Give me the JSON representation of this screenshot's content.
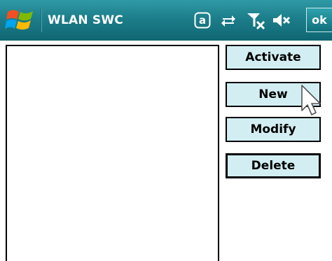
{
  "titlebar": {
    "title": "WLAN SWC",
    "ok_label": "ok",
    "start_icon": "windows-flag-icon",
    "status_icons": [
      "notification-a-icon",
      "connectivity-arrows-icon",
      "no-signal-icon",
      "speaker-muted-icon"
    ]
  },
  "buttons": {
    "activate": "Activate",
    "new": "New",
    "modify": "Modify",
    "delete": "Delete"
  },
  "list": {
    "items": []
  },
  "colors": {
    "titlebar": "#1c7e8a",
    "button_face": "#d2eef3",
    "border": "#000000"
  }
}
